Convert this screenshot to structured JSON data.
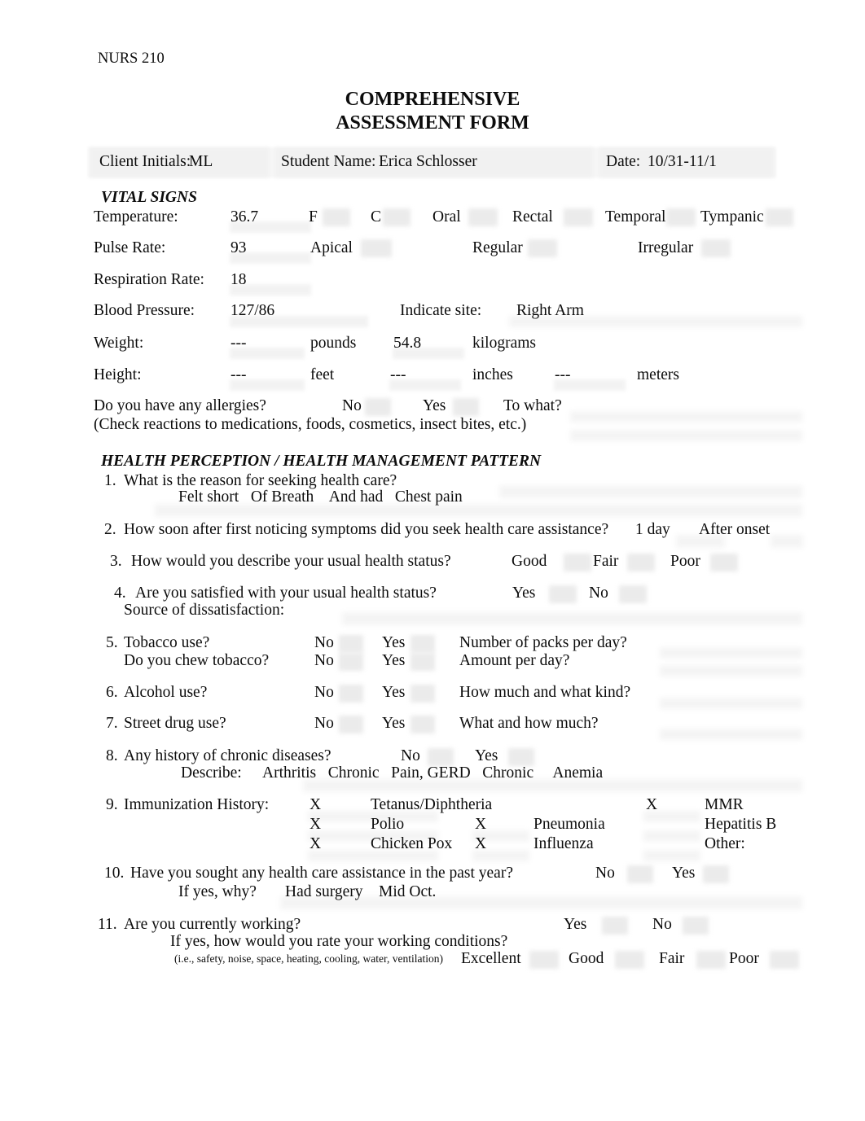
{
  "document": {
    "course_code": "NURS 210",
    "title_line1": "COMPREHENSIVE",
    "title_line2": "ASSESSMENT FORM"
  },
  "header": {
    "client_initials_label": "Client Initials:",
    "client_initials_value": "ML",
    "student_name_label": "Student Name:",
    "student_name_value": "Erica Schlosser",
    "date_label": "Date:",
    "date_value": "10/31-11/1"
  },
  "vital_signs": {
    "section_title": "VITAL SIGNS",
    "temperature": {
      "label": "Temperature:",
      "value": "36.7",
      "options": [
        "F",
        "C",
        "Oral",
        "Rectal",
        "Temporal",
        "Tympanic"
      ]
    },
    "pulse": {
      "label": "Pulse Rate:",
      "value": "93",
      "options": [
        "Apical",
        "Regular",
        "Irregular"
      ]
    },
    "respiration": {
      "label": "Respiration Rate:",
      "value": "18"
    },
    "blood_pressure": {
      "label": "Blood Pressure:",
      "value": "127/86",
      "site_label": "Indicate site:",
      "site_value": "Right Arm"
    },
    "weight": {
      "label": "Weight:",
      "pounds_value": "---",
      "pounds_unit": "pounds",
      "kilograms_value": "54.8",
      "kilograms_unit": "kilograms"
    },
    "height": {
      "label": "Height:",
      "feet_value": "---",
      "feet_unit": "feet",
      "inches_value": "---",
      "inches_unit": "inches",
      "meters_value": "---",
      "meters_unit": "meters"
    },
    "allergies": {
      "question": "Do you have any allergies?",
      "no": "No",
      "yes": "Yes",
      "to_what": "To what?",
      "note": "(Check reactions to medications, foods, cosmetics, insect bites, etc.)"
    }
  },
  "health_perception": {
    "section_title": "HEALTH PERCEPTION / HEALTH MANAGEMENT PATTERN",
    "q1": {
      "number": "1.",
      "text": "What is the reason for seeking health care?",
      "answer": "Felt short   Of Breath    And had   Chest pain"
    },
    "q2": {
      "number": "2.",
      "text": "How soon after first noticing symptoms did you seek health care assistance?",
      "answer_a": "1 day",
      "answer_b": "After onset"
    },
    "q3": {
      "number": "3.",
      "text": "How would you describe your usual health status?",
      "options": [
        "Good",
        "Fair",
        "Poor"
      ]
    },
    "q4": {
      "number": "4.",
      "text": "Are you satisfied with your usual health status?",
      "options": [
        "Yes",
        "No"
      ],
      "subtext": "Source of dissatisfaction:"
    },
    "q5": {
      "number": "5.",
      "text": "Tobacco use?",
      "no": "No",
      "yes": "Yes",
      "followup": "Number of packs per day?",
      "text_b": "Do you chew tobacco?",
      "no_b": "No",
      "yes_b": "Yes",
      "followup_b": "Amount per day?"
    },
    "q6": {
      "number": "6.",
      "text": "Alcohol use?",
      "no": "No",
      "yes": "Yes",
      "followup": "How much and what kind?"
    },
    "q7": {
      "number": "7.",
      "text": "Street drug use?",
      "no": "No",
      "yes": "Yes",
      "followup": "What and how much?"
    },
    "q8": {
      "number": "8.",
      "text": "Any history of chronic diseases?",
      "no": "No",
      "yes": "Yes",
      "describe_label": "Describe:",
      "describe_value": "Arthritis   Chronic   Pain, GERD   Chronic     Anemia"
    },
    "q9": {
      "number": "9.",
      "text": "Immunization History:",
      "rows": [
        {
          "mark1": "X",
          "label1": "Tetanus/Diphtheria",
          "mark2": "",
          "label2": "",
          "mark3": "X",
          "label3": "MMR"
        },
        {
          "mark1": "X",
          "label1": "Polio",
          "mark2": "X",
          "label2": "Pneumonia",
          "mark3": "",
          "label3": "Hepatitis B"
        },
        {
          "mark1": "X",
          "label1": "Chicken Pox",
          "mark2": "X",
          "label2": "Influenza",
          "mark3": "",
          "label3": "Other:"
        }
      ]
    },
    "q10": {
      "number": "10.",
      "text": "Have you sought any health care assistance in the past year?",
      "no": "No",
      "yes": "Yes",
      "why_label": "If yes, why?",
      "why_value": "Had surgery    Mid Oct."
    },
    "q11": {
      "number": "11.",
      "text": "Are you currently working?",
      "yes": "Yes",
      "no": "No",
      "subtext": "If yes, how would you rate your working conditions?",
      "note": "(i.e., safety, noise, space, heating, cooling, water, ventilation)",
      "options": [
        "Excellent",
        "Good",
        "Fair",
        "Poor"
      ]
    }
  }
}
